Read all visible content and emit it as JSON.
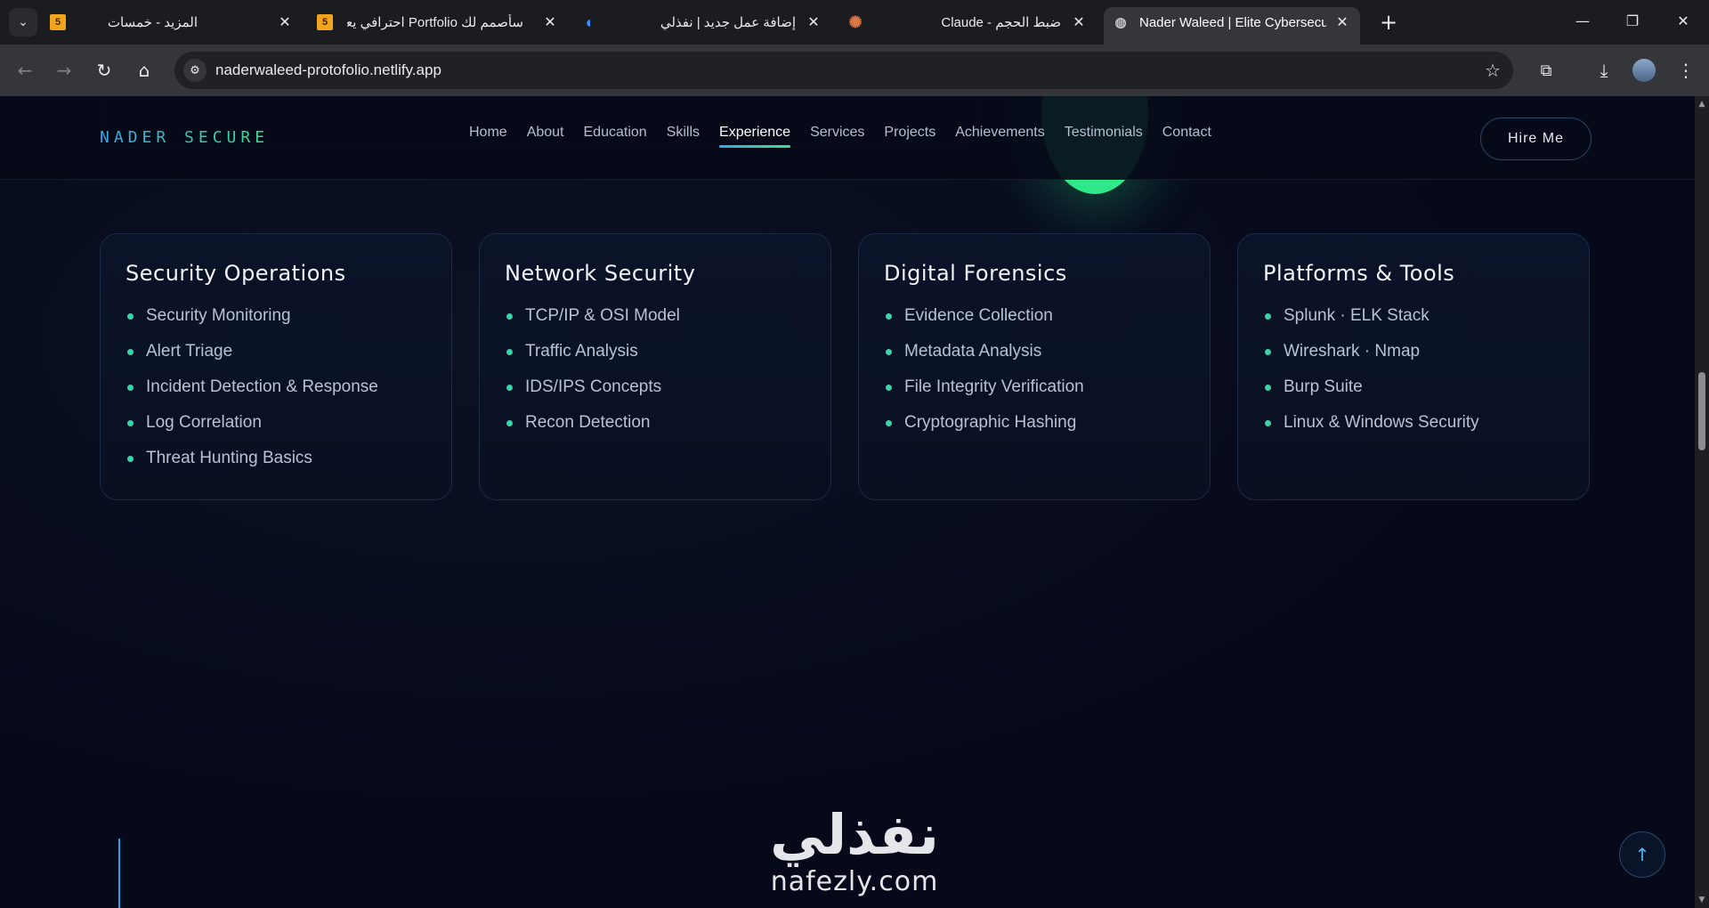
{
  "browser": {
    "tabs": [
      {
        "title": "المزيد - خمسات",
        "favicon": "5"
      },
      {
        "title": "سأصمم لك Portfolio احترافي يعر",
        "favicon": "5"
      },
      {
        "title": "إضافة عمل جديد | نفذلي",
        "favicon": "nafezly-icon"
      },
      {
        "title": "Claude - ضبط الحجم",
        "favicon": "claude-icon"
      },
      {
        "title": "Nader Waleed | Elite Cybersecur",
        "favicon": "globe-icon"
      }
    ],
    "url": "naderwaleed-protofolio.netlify.app"
  },
  "site": {
    "logo": "NADER SECURE",
    "nav": [
      "Home",
      "About",
      "Education",
      "Skills",
      "Experience",
      "Services",
      "Projects",
      "Achievements",
      "Testimonials",
      "Contact"
    ],
    "active_nav": "Experience",
    "hire_label": "Hire Me"
  },
  "cards": [
    {
      "title": "Security Operations",
      "items": [
        "Security Monitoring",
        "Alert Triage",
        "Incident Detection & Response",
        "Log Correlation",
        "Threat Hunting Basics"
      ]
    },
    {
      "title": "Network Security",
      "items": [
        "TCP/IP & OSI Model",
        "Traffic Analysis",
        "IDS/IPS Concepts",
        "Recon Detection"
      ]
    },
    {
      "title": "Digital Forensics",
      "items": [
        "Evidence Collection",
        "Metadata Analysis",
        "File Integrity Verification",
        "Cryptographic Hashing"
      ]
    },
    {
      "title": "Platforms & Tools",
      "items": [
        "Splunk · ELK Stack",
        "Wireshark · Nmap",
        "Burp Suite",
        "Linux & Windows Security"
      ]
    }
  ],
  "watermark": {
    "arabic": "نفذلي",
    "latin": "nafezly.com"
  },
  "colors": {
    "accent_blue": "#36a8e6",
    "accent_green": "#38e28c",
    "background": "#06091a"
  }
}
